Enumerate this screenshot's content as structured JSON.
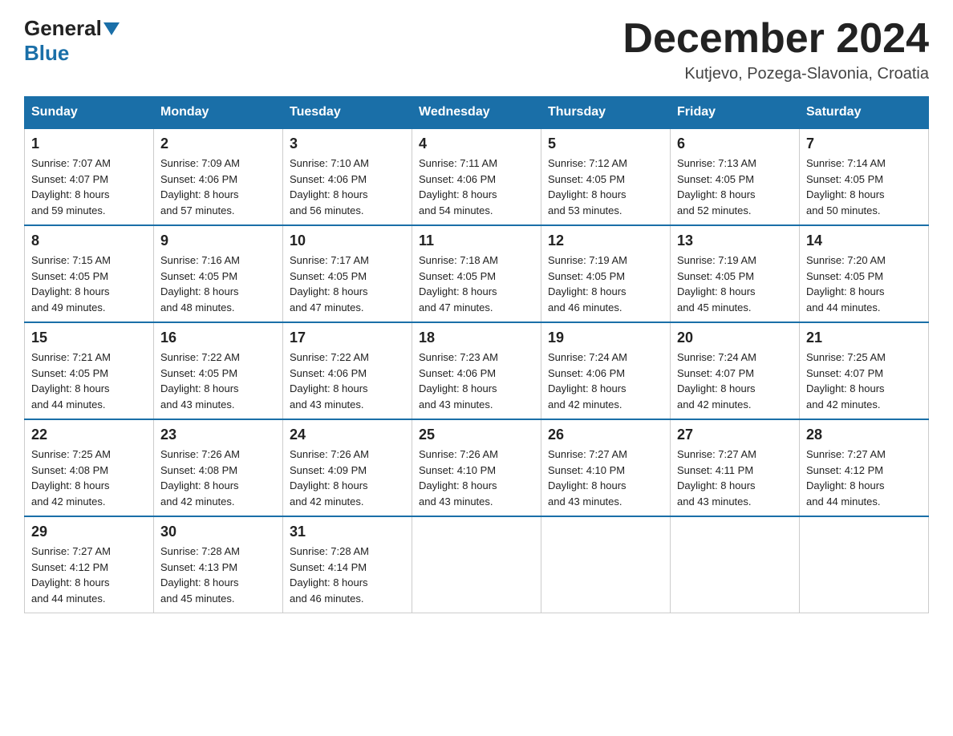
{
  "header": {
    "title": "December 2024",
    "location": "Kutjevo, Pozega-Slavonia, Croatia",
    "logo_general": "General",
    "logo_blue": "Blue"
  },
  "days_of_week": [
    "Sunday",
    "Monday",
    "Tuesday",
    "Wednesday",
    "Thursday",
    "Friday",
    "Saturday"
  ],
  "weeks": [
    [
      {
        "day": "1",
        "sunrise": "7:07 AM",
        "sunset": "4:07 PM",
        "daylight": "8 hours and 59 minutes."
      },
      {
        "day": "2",
        "sunrise": "7:09 AM",
        "sunset": "4:06 PM",
        "daylight": "8 hours and 57 minutes."
      },
      {
        "day": "3",
        "sunrise": "7:10 AM",
        "sunset": "4:06 PM",
        "daylight": "8 hours and 56 minutes."
      },
      {
        "day": "4",
        "sunrise": "7:11 AM",
        "sunset": "4:06 PM",
        "daylight": "8 hours and 54 minutes."
      },
      {
        "day": "5",
        "sunrise": "7:12 AM",
        "sunset": "4:05 PM",
        "daylight": "8 hours and 53 minutes."
      },
      {
        "day": "6",
        "sunrise": "7:13 AM",
        "sunset": "4:05 PM",
        "daylight": "8 hours and 52 minutes."
      },
      {
        "day": "7",
        "sunrise": "7:14 AM",
        "sunset": "4:05 PM",
        "daylight": "8 hours and 50 minutes."
      }
    ],
    [
      {
        "day": "8",
        "sunrise": "7:15 AM",
        "sunset": "4:05 PM",
        "daylight": "8 hours and 49 minutes."
      },
      {
        "day": "9",
        "sunrise": "7:16 AM",
        "sunset": "4:05 PM",
        "daylight": "8 hours and 48 minutes."
      },
      {
        "day": "10",
        "sunrise": "7:17 AM",
        "sunset": "4:05 PM",
        "daylight": "8 hours and 47 minutes."
      },
      {
        "day": "11",
        "sunrise": "7:18 AM",
        "sunset": "4:05 PM",
        "daylight": "8 hours and 47 minutes."
      },
      {
        "day": "12",
        "sunrise": "7:19 AM",
        "sunset": "4:05 PM",
        "daylight": "8 hours and 46 minutes."
      },
      {
        "day": "13",
        "sunrise": "7:19 AM",
        "sunset": "4:05 PM",
        "daylight": "8 hours and 45 minutes."
      },
      {
        "day": "14",
        "sunrise": "7:20 AM",
        "sunset": "4:05 PM",
        "daylight": "8 hours and 44 minutes."
      }
    ],
    [
      {
        "day": "15",
        "sunrise": "7:21 AM",
        "sunset": "4:05 PM",
        "daylight": "8 hours and 44 minutes."
      },
      {
        "day": "16",
        "sunrise": "7:22 AM",
        "sunset": "4:05 PM",
        "daylight": "8 hours and 43 minutes."
      },
      {
        "day": "17",
        "sunrise": "7:22 AM",
        "sunset": "4:06 PM",
        "daylight": "8 hours and 43 minutes."
      },
      {
        "day": "18",
        "sunrise": "7:23 AM",
        "sunset": "4:06 PM",
        "daylight": "8 hours and 43 minutes."
      },
      {
        "day": "19",
        "sunrise": "7:24 AM",
        "sunset": "4:06 PM",
        "daylight": "8 hours and 42 minutes."
      },
      {
        "day": "20",
        "sunrise": "7:24 AM",
        "sunset": "4:07 PM",
        "daylight": "8 hours and 42 minutes."
      },
      {
        "day": "21",
        "sunrise": "7:25 AM",
        "sunset": "4:07 PM",
        "daylight": "8 hours and 42 minutes."
      }
    ],
    [
      {
        "day": "22",
        "sunrise": "7:25 AM",
        "sunset": "4:08 PM",
        "daylight": "8 hours and 42 minutes."
      },
      {
        "day": "23",
        "sunrise": "7:26 AM",
        "sunset": "4:08 PM",
        "daylight": "8 hours and 42 minutes."
      },
      {
        "day": "24",
        "sunrise": "7:26 AM",
        "sunset": "4:09 PM",
        "daylight": "8 hours and 42 minutes."
      },
      {
        "day": "25",
        "sunrise": "7:26 AM",
        "sunset": "4:10 PM",
        "daylight": "8 hours and 43 minutes."
      },
      {
        "day": "26",
        "sunrise": "7:27 AM",
        "sunset": "4:10 PM",
        "daylight": "8 hours and 43 minutes."
      },
      {
        "day": "27",
        "sunrise": "7:27 AM",
        "sunset": "4:11 PM",
        "daylight": "8 hours and 43 minutes."
      },
      {
        "day": "28",
        "sunrise": "7:27 AM",
        "sunset": "4:12 PM",
        "daylight": "8 hours and 44 minutes."
      }
    ],
    [
      {
        "day": "29",
        "sunrise": "7:27 AM",
        "sunset": "4:12 PM",
        "daylight": "8 hours and 44 minutes."
      },
      {
        "day": "30",
        "sunrise": "7:28 AM",
        "sunset": "4:13 PM",
        "daylight": "8 hours and 45 minutes."
      },
      {
        "day": "31",
        "sunrise": "7:28 AM",
        "sunset": "4:14 PM",
        "daylight": "8 hours and 46 minutes."
      },
      null,
      null,
      null,
      null
    ]
  ],
  "labels": {
    "sunrise": "Sunrise:",
    "sunset": "Sunset:",
    "daylight": "Daylight:"
  }
}
